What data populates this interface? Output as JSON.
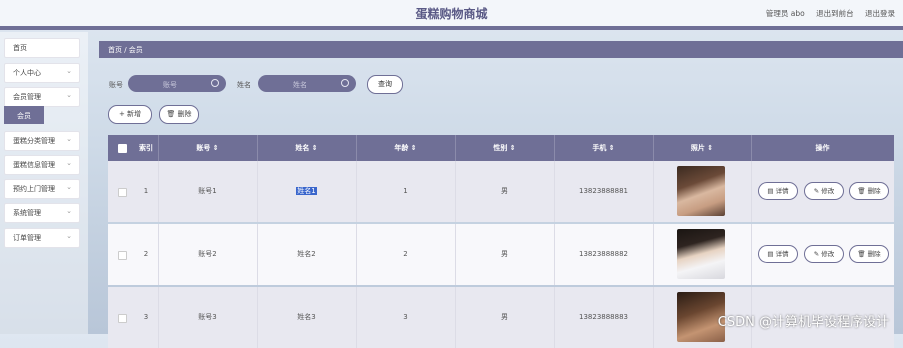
{
  "header": {
    "title": "蛋糕购物商城",
    "admin_label": "管理员 abo",
    "back_to_front": "退出到前台",
    "logout": "退出登录"
  },
  "sidebar": {
    "items": [
      {
        "label": "首页",
        "has_chevron": false
      },
      {
        "label": "个人中心",
        "has_chevron": true
      },
      {
        "label": "会员管理",
        "has_chevron": true
      },
      {
        "label": "蛋糕分类管理",
        "has_chevron": true
      },
      {
        "label": "蛋糕信息管理",
        "has_chevron": true
      },
      {
        "label": "预约上门管理",
        "has_chevron": true
      },
      {
        "label": "系统管理",
        "has_chevron": true
      },
      {
        "label": "订单管理",
        "has_chevron": true
      }
    ],
    "sub_active": "会员",
    "chevron_glyph": "⌄"
  },
  "breadcrumb": {
    "text": "首页 / 会员"
  },
  "search": {
    "account_label": "账号",
    "account_placeholder": "账号",
    "name_label": "姓名",
    "name_placeholder": "姓名",
    "query_button": "查询"
  },
  "actions": {
    "add_button": "+ 新增",
    "delete_button": "删除"
  },
  "table": {
    "columns": [
      "索引",
      "账号 ⇕",
      "姓名 ⇕",
      "年龄 ⇕",
      "性别 ⇕",
      "手机 ⇕",
      "照片 ⇕",
      "操作"
    ],
    "rows": [
      {
        "index": "1",
        "account": "账号1",
        "name": "姓名1",
        "age": "1",
        "gender": "男",
        "phone": "13823888881"
      },
      {
        "index": "2",
        "account": "账号2",
        "name": "姓名2",
        "age": "2",
        "gender": "男",
        "phone": "13823888882"
      },
      {
        "index": "3",
        "account": "账号3",
        "name": "姓名3",
        "age": "3",
        "gender": "男",
        "phone": "13823888883"
      }
    ],
    "row_actions": {
      "detail": "详情",
      "edit": "修改",
      "delete": "删除"
    }
  },
  "watermark": "CSDN @计算机毕设程序设计",
  "colors": {
    "accent": "#6f6f96",
    "selection": "#3a66cc"
  }
}
